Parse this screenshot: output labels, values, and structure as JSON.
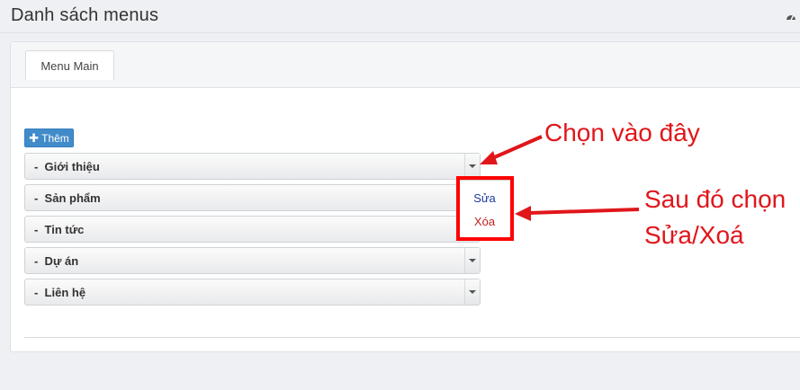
{
  "header": {
    "title": "Danh sách menus",
    "dashboard_icon": "dashboard-icon"
  },
  "tabs": [
    {
      "label": "Menu Main",
      "active": true
    }
  ],
  "toolbar": {
    "add_label": "Thêm",
    "add_icon": "plus-icon"
  },
  "menu_items": [
    {
      "label": "-  Giới thiệu",
      "dropdown_open": true
    },
    {
      "label": "-  Sản phẩm"
    },
    {
      "label": "-  Tin tức"
    },
    {
      "label": "-  Dự án"
    },
    {
      "label": "-  Liên hệ"
    }
  ],
  "dropdown": {
    "edit_label": "Sửa",
    "delete_label": "Xóa"
  },
  "annotations": {
    "click_here": "Chọn vào đây",
    "then_choose_line1": "Sau đó chọn",
    "then_choose_line2": "Sửa/Xoá",
    "color": "#e0161b"
  },
  "colors": {
    "primary_button": "#428bca",
    "edit_link": "#1a3a9e",
    "delete_link": "#c42020",
    "highlight": "#ff0000"
  }
}
